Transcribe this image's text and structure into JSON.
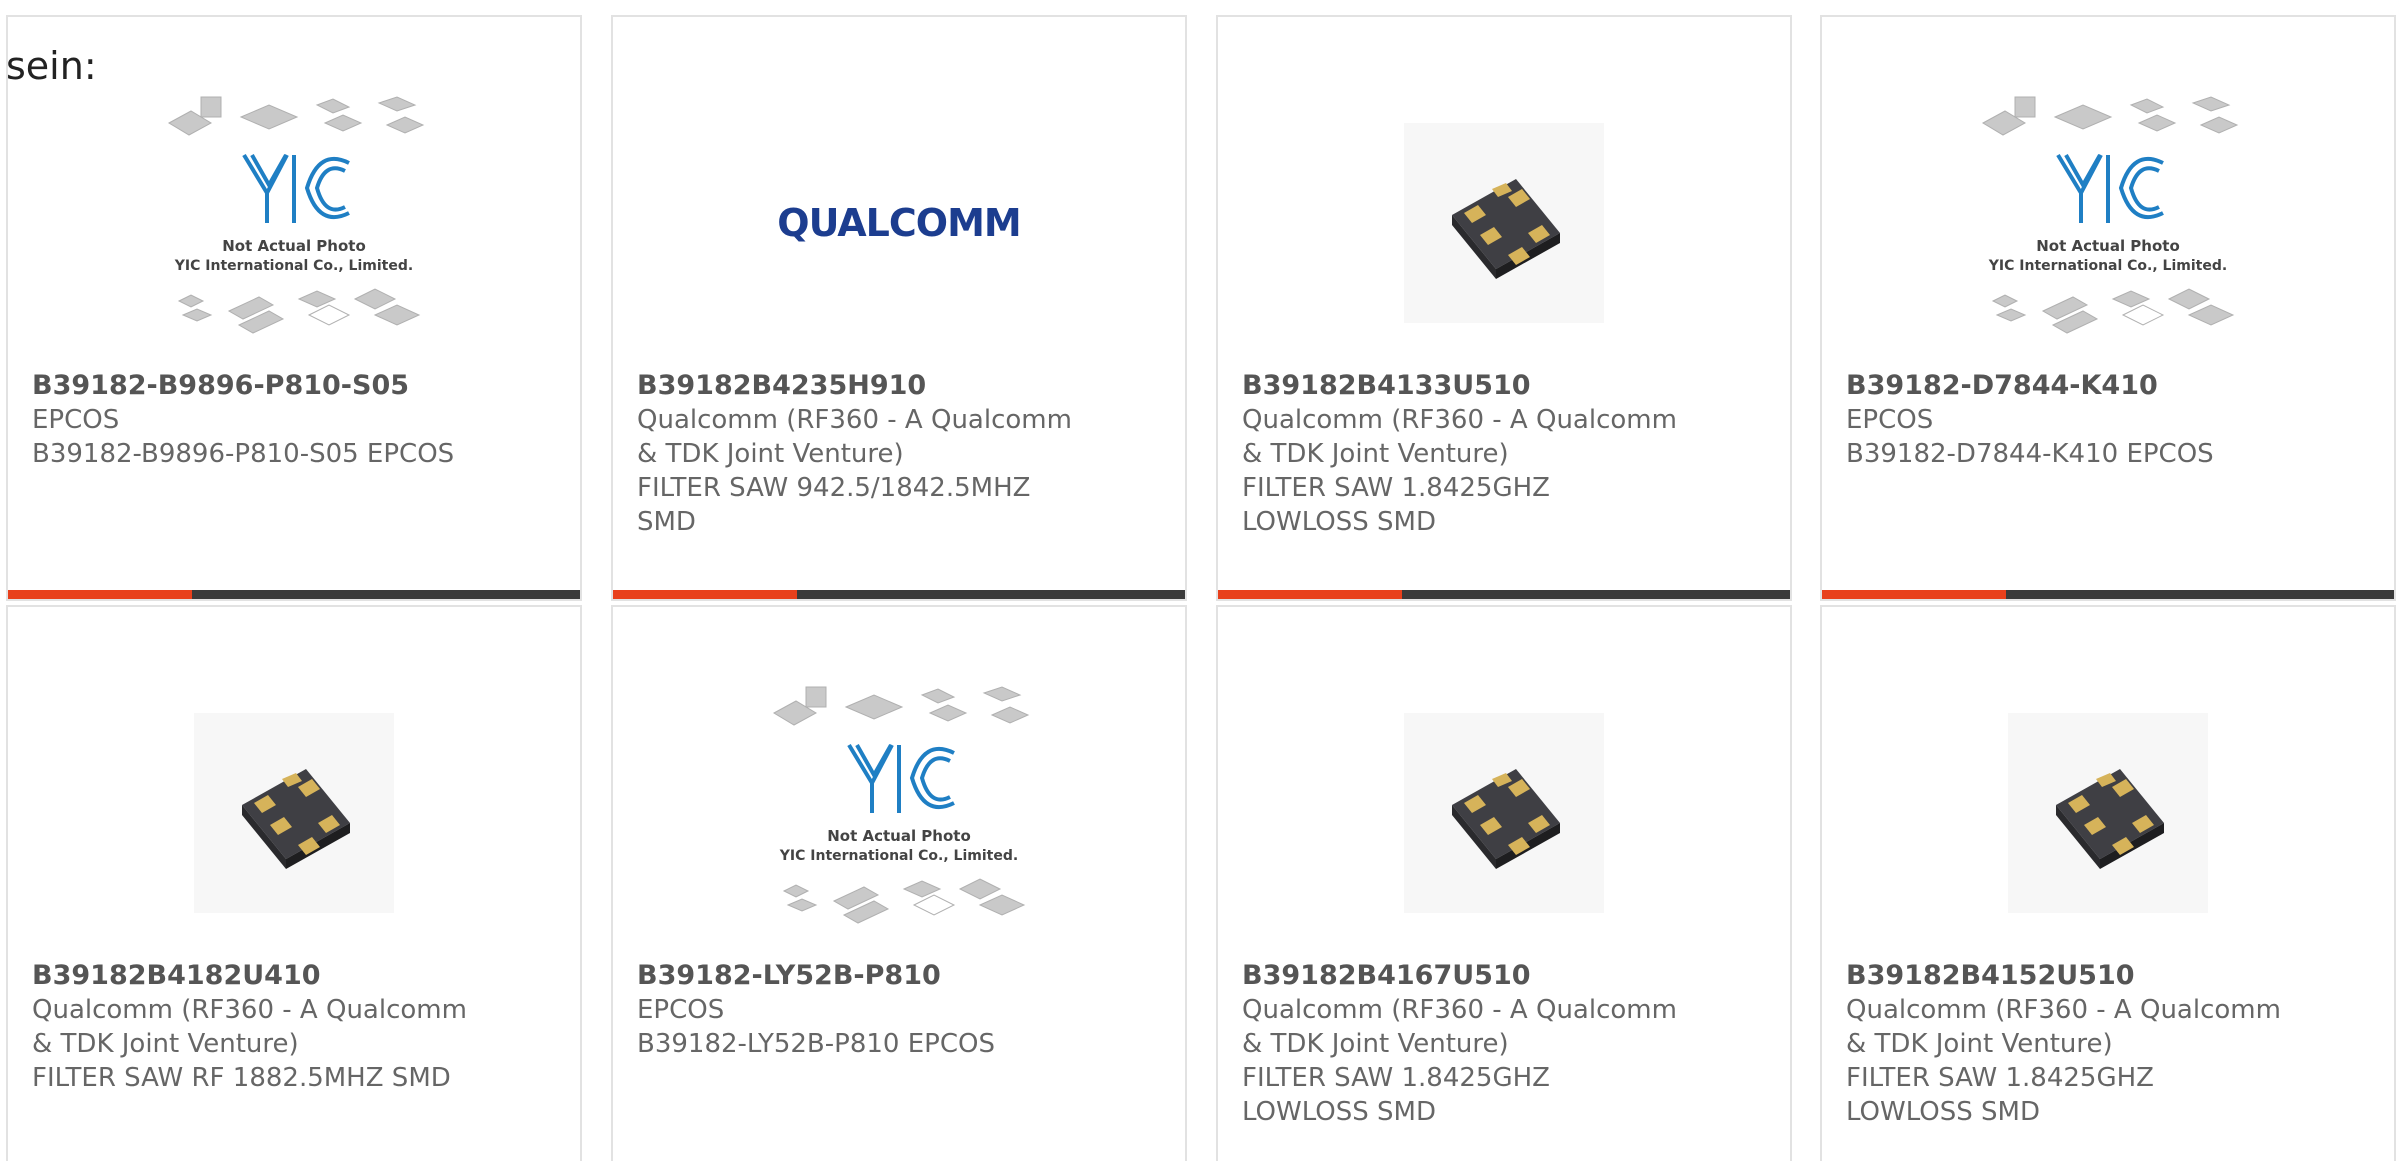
{
  "intro_text": "sein:",
  "placeholder_yic": {
    "line1": "Not Actual Photo",
    "line2": "YIC International Co., Limited.",
    "logo": "YIC"
  },
  "qualcomm_logo": "QUALCOMM",
  "colors": {
    "accent": "#e8401c",
    "bar": "#3a3a3a",
    "yic_blue": "#1f7fc4",
    "qualcomm_blue": "#1c3d8f"
  },
  "products": [
    {
      "part": "B39182-B9896-P810-S05",
      "maker": "EPCOS",
      "desc": "B39182-B9896-P810-S05 EPCOS",
      "image": "yic-placeholder"
    },
    {
      "part": "B39182B4235H910",
      "maker": "Qualcomm (RF360 - A Qualcomm & TDK Joint Venture)",
      "desc": "FILTER SAW 942.5/1842.5MHZ SMD",
      "image": "qualcomm-logo"
    },
    {
      "part": "B39182B4133U510",
      "maker": "Qualcomm (RF360 - A Qualcomm & TDK Joint Venture)",
      "desc": "FILTER SAW 1.8425GHZ LOWLOSS SMD",
      "image": "saw-chip"
    },
    {
      "part": "B39182-D7844-K410",
      "maker": "EPCOS",
      "desc": "B39182-D7844-K410 EPCOS",
      "image": "yic-placeholder"
    },
    {
      "part": "B39182B4182U410",
      "maker": "Qualcomm (RF360 - A Qualcomm & TDK Joint Venture)",
      "desc": "FILTER SAW RF 1882.5MHZ SMD",
      "image": "saw-chip"
    },
    {
      "part": "B39182-LY52B-P810",
      "maker": "EPCOS",
      "desc": "B39182-LY52B-P810 EPCOS",
      "image": "yic-placeholder"
    },
    {
      "part": "B39182B4167U510",
      "maker": "Qualcomm (RF360 - A Qualcomm & TDK Joint Venture)",
      "desc": "FILTER SAW 1.8425GHZ LOWLOSS SMD",
      "image": "saw-chip"
    },
    {
      "part": "B39182B4152U510",
      "maker": "Qualcomm (RF360 - A Qualcomm & TDK Joint Venture)",
      "desc": "FILTER SAW 1.8425GHZ LOWLOSS SMD",
      "image": "saw-chip"
    }
  ]
}
